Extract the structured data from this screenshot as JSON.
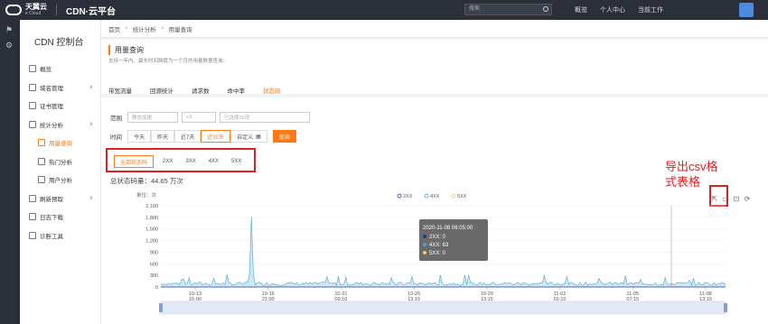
{
  "topbar": {
    "logo_text": "天翼云",
    "logo_sub": "e Cloud",
    "brand": "CDN·云平台",
    "search_placeholder": "搜索",
    "nav": [
      "概览",
      "个人中心",
      "当前工作"
    ]
  },
  "sidebar": {
    "title": "CDN 控制台",
    "items": [
      {
        "label": "概览",
        "icon": "overview-icon"
      },
      {
        "label": "域名管理",
        "icon": "domain-icon",
        "chevron": "∨"
      },
      {
        "label": "证书管理",
        "icon": "certificate-icon"
      },
      {
        "label": "统计分析",
        "icon": "stats-icon",
        "chevron": "∧"
      },
      {
        "label": "用量查询",
        "icon": "usage-icon",
        "sub": true,
        "active": true
      },
      {
        "label": "热门分析",
        "icon": "hot-icon",
        "sub": true
      },
      {
        "label": "用户分析",
        "icon": "user-icon",
        "sub": true
      },
      {
        "label": "刷新预取",
        "icon": "refresh-icon",
        "chevron": "∨"
      },
      {
        "label": "日志下载",
        "icon": "log-icon"
      },
      {
        "label": "诊断工具",
        "icon": "diagnose-icon"
      }
    ]
  },
  "breadcrumb": [
    "首页",
    "统计分析",
    "用量查询"
  ],
  "page": {
    "title": "用量查询",
    "desc": "支持一年内、最长时间跨度为一个月的用量数据查询。"
  },
  "tabs": [
    "带宽流量",
    "回源统计",
    "请求数",
    "命中率",
    "状态码"
  ],
  "active_tab": 4,
  "filter": {
    "range_label": "范围",
    "domain_value": "静态加速",
    "count": "+3",
    "selected": "已选择15项",
    "time_label": "时间",
    "time_buttons": [
      "今天",
      "昨天",
      "近7天",
      "近30天",
      "自定义"
    ],
    "active_time": 3,
    "custom_icon": "calendar-icon",
    "query_button": "查询"
  },
  "status_buttons": [
    "全部状态码",
    "2XX",
    "3XX",
    "4XX",
    "5XX"
  ],
  "total": "总状态码量：44.65 万次",
  "annotation": [
    "导出csv格",
    "式表格"
  ],
  "toolbar_icons": [
    "export-icon",
    "window-icon",
    "crop-icon",
    "reset-icon"
  ],
  "colors": {
    "accent": "#ff7a16",
    "series_2xx": "#1f3b8f",
    "series_4xx": "#46a3d9",
    "series_5xx": "#f5c86a",
    "highlight": "#e02020"
  },
  "chart_data": {
    "type": "line",
    "title": "",
    "ylabel": "单位：次",
    "ylim": [
      0,
      2100
    ],
    "yticks": [
      0,
      300,
      600,
      900,
      1200,
      1500,
      1800,
      2100
    ],
    "xticks": [
      "10-13\n15:00",
      "10-16\n21:00",
      "10-21\n09:10",
      "10-26\n13:15",
      "10-29\n13:15",
      "11-02\n01:15",
      "11-05\n07:15",
      "11-08\n13:15"
    ],
    "legend": [
      "2XX",
      "4XX",
      "5XX"
    ],
    "legend_position": "top",
    "series": [
      {
        "name": "2XX",
        "values": [
          0,
          0,
          0,
          0,
          0,
          0,
          0,
          0
        ]
      },
      {
        "name": "4XX",
        "values": [
          60,
          1800,
          120,
          150,
          130,
          110,
          160,
          63
        ],
        "peak_note": "baseline ~30-150, spike ~1800 near 10-15"
      },
      {
        "name": "5XX",
        "values": [
          0,
          0,
          0,
          0,
          0,
          0,
          0,
          0
        ]
      }
    ],
    "tooltip": {
      "title": "2020-11-08 06:05:00",
      "rows": [
        "2XX: 0",
        "4XX: 63",
        "5XX: 0"
      ]
    }
  }
}
